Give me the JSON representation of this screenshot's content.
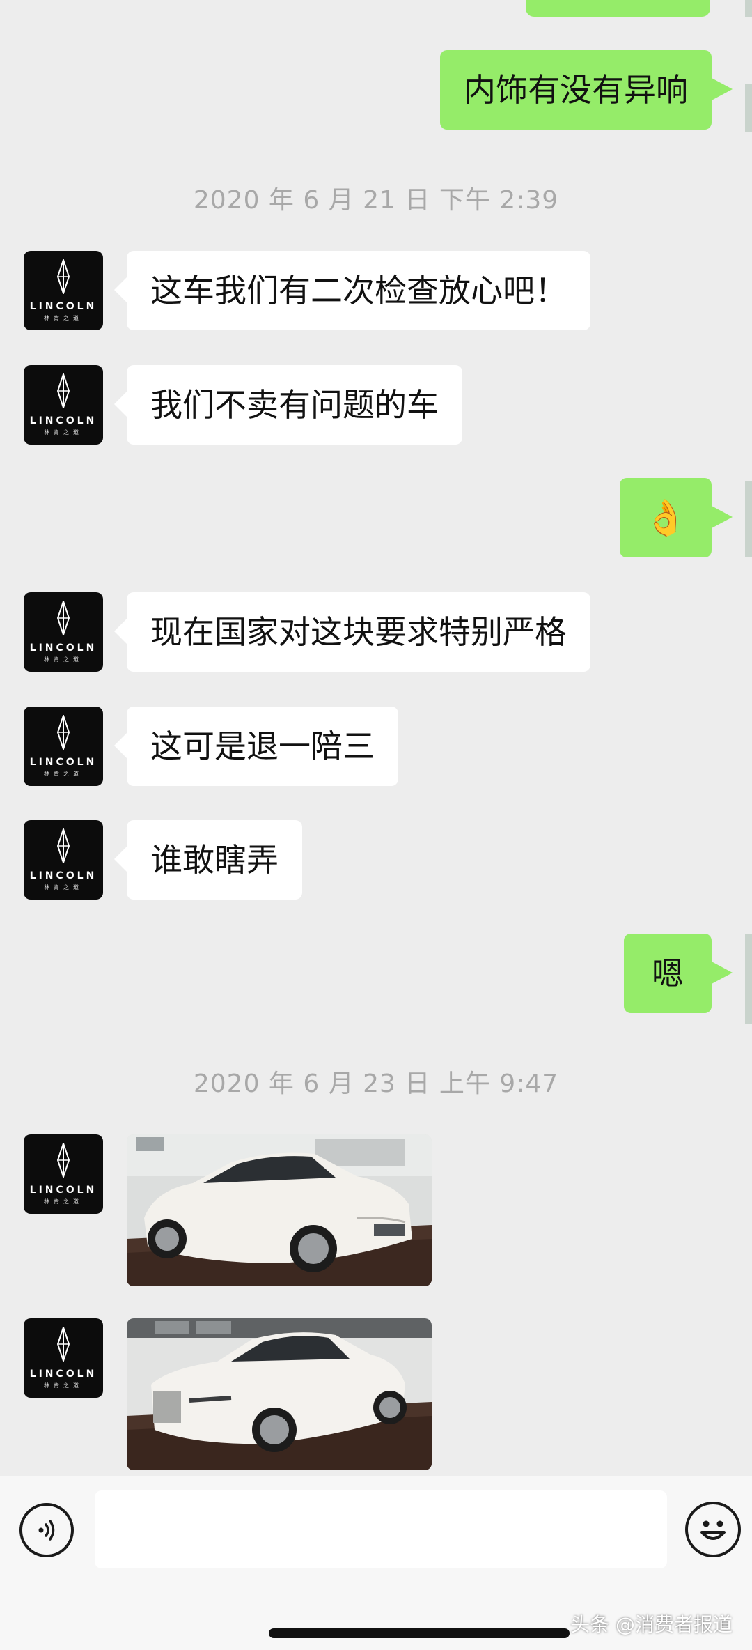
{
  "messages": {
    "m1": "内饰有没有异响",
    "ts1": "2020 年 6 月 21 日  下午 2:39",
    "m2": "这车我们有二次检查放心吧！",
    "m3": "我们不卖有问题的车",
    "m4": "👌",
    "m5": "现在国家对这块要求特别严格",
    "m6": "这可是退一陪三",
    "m7": "谁敢瞎弄",
    "m8": "嗯",
    "ts2": "2020 年 6 月 23 日  上午 9:47"
  },
  "avatar": {
    "brand": "LINCOLN",
    "brand_sub": "林肯之道"
  },
  "icons": {
    "voice": "voice-icon",
    "emoji": "emoji-icon"
  },
  "watermark": "头条 @消费者报道",
  "colors": {
    "background": "#ededed",
    "sent_bubble": "#95ec69",
    "received_bubble": "#ffffff",
    "timestamp": "#a8a8a8"
  }
}
